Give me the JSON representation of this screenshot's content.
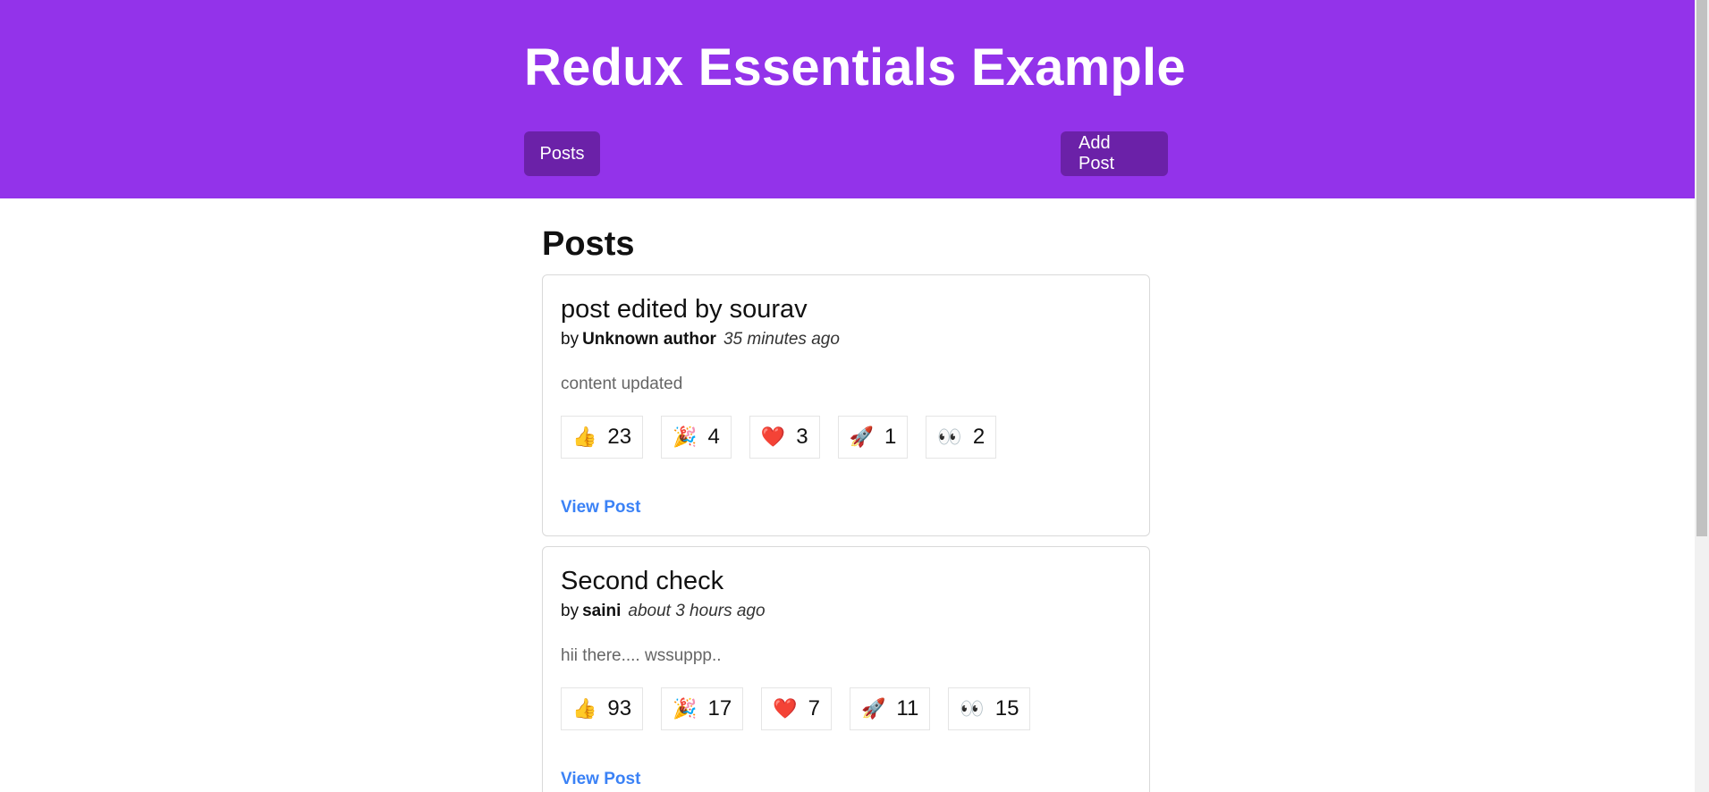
{
  "navbar": {
    "title": "Redux Essentials Example",
    "posts_label": "Posts",
    "add_post_label": "Add Post"
  },
  "main": {
    "heading": "Posts",
    "view_link_label": "View Post",
    "posts": [
      {
        "title": "post edited by sourav",
        "by": "by",
        "author": "Unknown author",
        "time": "35 minutes ago",
        "content": "content updated",
        "reactions": [
          {
            "icon": "thumbs-up-icon",
            "emoji": "👍",
            "count": "23"
          },
          {
            "icon": "party-popper-icon",
            "emoji": "🎉",
            "count": "4"
          },
          {
            "icon": "heart-icon",
            "emoji": "❤️",
            "count": "3"
          },
          {
            "icon": "rocket-icon",
            "emoji": "🚀",
            "count": "1"
          },
          {
            "icon": "eyes-icon",
            "emoji": "👀",
            "count": "2"
          }
        ]
      },
      {
        "title": "Second check",
        "by": "by",
        "author": "saini",
        "time": "about 3 hours ago",
        "content": "hii there.... wssuppp..",
        "reactions": [
          {
            "icon": "thumbs-up-icon",
            "emoji": "👍",
            "count": "93"
          },
          {
            "icon": "party-popper-icon",
            "emoji": "🎉",
            "count": "17"
          },
          {
            "icon": "heart-icon",
            "emoji": "❤️",
            "count": "7"
          },
          {
            "icon": "rocket-icon",
            "emoji": "🚀",
            "count": "11"
          },
          {
            "icon": "eyes-icon",
            "emoji": "👀",
            "count": "15"
          }
        ]
      }
    ]
  },
  "colors": {
    "navbar_bg": "#9333ea",
    "nav_button_bg": "#6b21a8",
    "link": "#3b82f6"
  }
}
